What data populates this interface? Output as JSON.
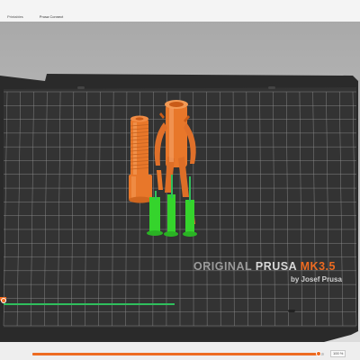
{
  "tabs": [
    {
      "label": "Printables"
    },
    {
      "label": "Prusa Connect"
    }
  ],
  "bed": {
    "brand_prefix": "ORIGINAL ",
    "brand_name": "PRUSA ",
    "model": "MK3.5",
    "maker_line": "by Josef Prusa",
    "color_bed": "#2b2b2b",
    "color_grid": "#9a9a9a",
    "color_accent": "#ed6b21"
  },
  "objects": [
    {
      "name": "screw"
    },
    {
      "name": "figurine"
    }
  ],
  "model_color": "#ed7a2a",
  "support_color": "#35d42c",
  "layer_slider": {
    "value_label": "100 %",
    "position_fraction": 0.98
  },
  "icons": [
    "orange-marker-icon",
    "slider-knob-icon"
  ]
}
